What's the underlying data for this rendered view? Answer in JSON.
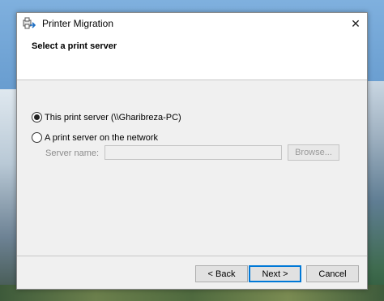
{
  "window": {
    "title": "Printer Migration",
    "close_glyph": "✕",
    "header_title": "Select a print server"
  },
  "options": {
    "this_server_label": "This print server (\\\\Gharibreza-PC)",
    "this_server_selected": true,
    "network_server_label": "A print server on the network",
    "network_server_selected": false
  },
  "server_field": {
    "label": "Server name:",
    "value": "",
    "browse_label": "Browse..."
  },
  "buttons": {
    "back": "< Back",
    "next": "Next >",
    "cancel": "Cancel"
  },
  "colors": {
    "accent": "#0078d7",
    "disabled_text": "#8c8c8c"
  },
  "icons": {
    "app": "printer-migration-icon",
    "close": "close-icon"
  }
}
